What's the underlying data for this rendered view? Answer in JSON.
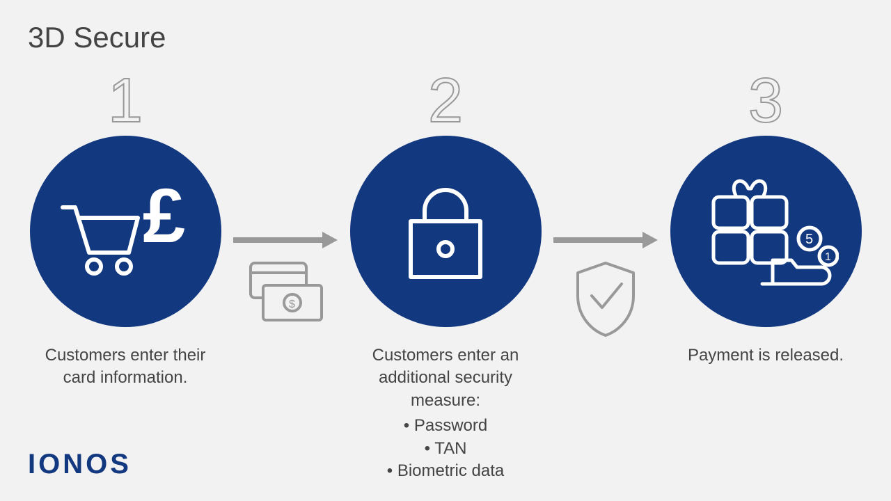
{
  "title": "3D Secure",
  "brand": "IONOS",
  "colors": {
    "primary": "#12387f",
    "grey": "#999999",
    "text": "#444444",
    "bg": "#f2f2f2"
  },
  "steps": [
    {
      "number": "1",
      "icon": "cart-pound-icon",
      "caption": "Customers enter their card information.",
      "bullets": []
    },
    {
      "number": "2",
      "icon": "padlock-icon",
      "caption": "Customers enter an additional security measure:",
      "bullets": [
        "Password",
        "TAN",
        "Biometric data"
      ]
    },
    {
      "number": "3",
      "icon": "gift-hand-icon",
      "caption": "Payment is released.",
      "bullets": []
    }
  ],
  "connectors": [
    {
      "icon": "cards-money-icon"
    },
    {
      "icon": "shield-check-icon"
    }
  ]
}
